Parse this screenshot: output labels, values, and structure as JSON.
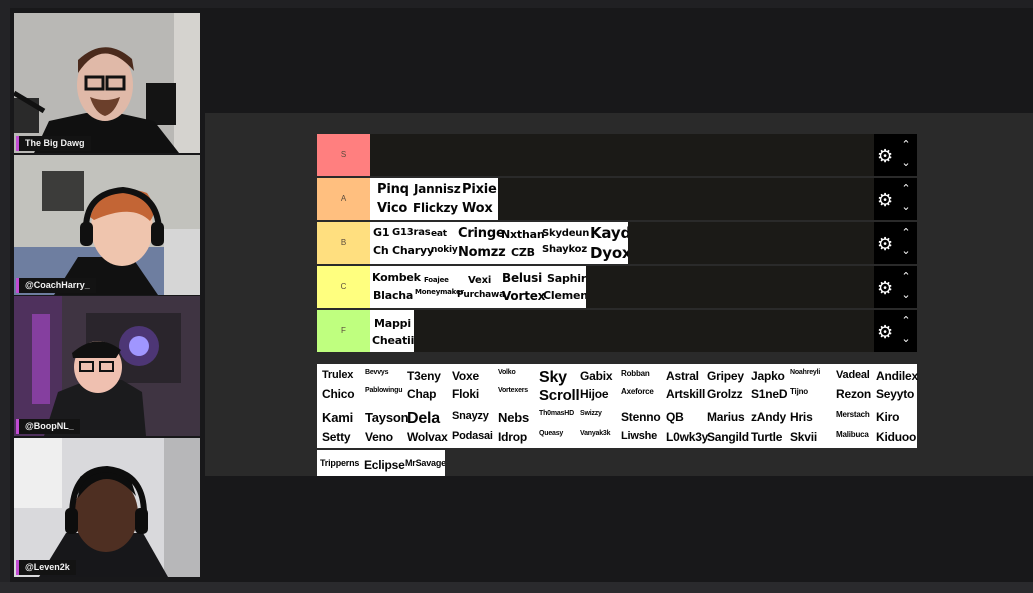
{
  "stream": {
    "cams": [
      {
        "name": "The Big Dawg"
      },
      {
        "name": "@CoachHarry_"
      },
      {
        "name": "@BoopNL_"
      },
      {
        "name": "@Leven2k"
      }
    ]
  },
  "tiers": [
    {
      "label": "S",
      "color": "#ff7f7f",
      "items": []
    },
    {
      "label": "A",
      "color": "#ffbf7f",
      "items": [
        [
          "Pinq",
          "Vico"
        ],
        [
          "Jannisz",
          "Flickzy"
        ],
        [
          "Pixie",
          "Wox"
        ]
      ]
    },
    {
      "label": "B",
      "color": "#ffdf7f",
      "items": [
        [
          "G1",
          "Ch"
        ],
        [
          "G13ras",
          "Charyy"
        ],
        [
          "eat",
          "nokiy"
        ],
        [
          "Cringe",
          "Nomzz"
        ],
        [
          "Nxthan",
          "CZB"
        ],
        [
          "Skydeun",
          "Shaykoz"
        ],
        [
          "Kayd",
          "Dyox"
        ]
      ]
    },
    {
      "label": "C",
      "color": "#ffff7f",
      "items": [
        [
          "Kombek",
          "Blacha"
        ],
        [
          "Foajee",
          "Moneymaker"
        ],
        [
          "Vexi",
          "Purchawa"
        ],
        [
          "Belusi",
          "Vortex"
        ],
        [
          "Saphir",
          "Clement"
        ]
      ]
    },
    {
      "label": "F",
      "color": "#bfff7f",
      "items": [
        [
          "Mappi",
          "Cheatiin"
        ]
      ]
    }
  ],
  "pool": [
    [
      "Trulex",
      "Chico",
      "Kami",
      "Setty"
    ],
    [
      "Bevvys",
      "Pablowingu",
      "Tayson",
      "Veno"
    ],
    [
      "T3eny",
      "Chap",
      "Dela",
      "Wolvax"
    ],
    [
      "Voxe",
      "Floki",
      "Snayzy",
      "Podasai"
    ],
    [
      "Volko",
      "Vortexers",
      "Nebs",
      "Idrop"
    ],
    [
      "Sky",
      "Scroll",
      "Th0masHD",
      "Queasy"
    ],
    [
      "Gabix",
      "Hijoe",
      "Swizzy",
      "Vanyak3k"
    ],
    [
      "Robban",
      "Axeforce",
      "Stenno",
      "Liwshe"
    ],
    [
      "Astral",
      "Artskill",
      "QB",
      "L0wk3y"
    ],
    [
      "Gripey",
      "Grolzz",
      "Marius",
      "Sangild"
    ],
    [
      "Japko",
      "S1neD",
      "zAndy",
      "Turtle"
    ],
    [
      "Noahreyli",
      "Tijno",
      "Hris",
      "Skvii"
    ],
    [
      "Vadeal",
      "Rezon",
      "Merstach",
      "Malibuca"
    ],
    [
      "Andilex",
      "Seyyto",
      "Kiro",
      "Kiduoo"
    ]
  ],
  "pool_overflow": [
    [
      "Tripperns",
      "Eclipse",
      "MrSavage"
    ]
  ],
  "icons": {
    "gear": "gear-icon",
    "up": "chevron-up-icon",
    "down": "chevron-down-icon"
  }
}
